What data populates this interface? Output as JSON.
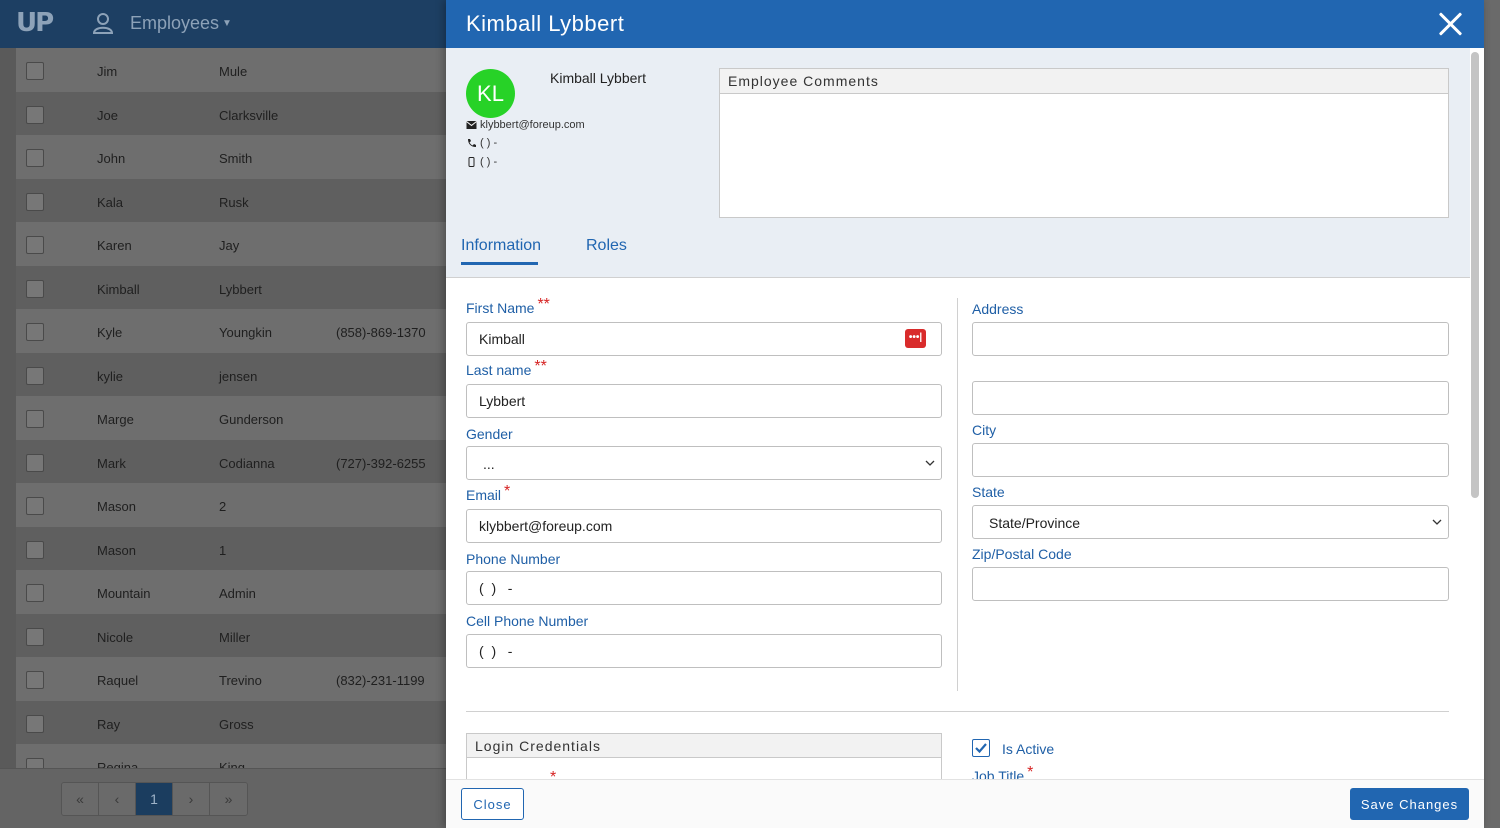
{
  "background": {
    "logo": "UP",
    "module_title": "Employees",
    "rows": [
      {
        "first": "Jim",
        "last": "Mule",
        "phone": ""
      },
      {
        "first": "Joe",
        "last": "Clarksville",
        "phone": ""
      },
      {
        "first": "John",
        "last": "Smith",
        "phone": ""
      },
      {
        "first": "Kala",
        "last": "Rusk",
        "phone": ""
      },
      {
        "first": "Karen",
        "last": "Jay",
        "phone": ""
      },
      {
        "first": "Kimball",
        "last": "Lybbert",
        "phone": ""
      },
      {
        "first": "Kyle",
        "last": "Youngkin",
        "phone": "(858)-869-1370"
      },
      {
        "first": "kylie",
        "last": "jensen",
        "phone": ""
      },
      {
        "first": "Marge",
        "last": "Gunderson",
        "phone": ""
      },
      {
        "first": "Mark",
        "last": "Codianna",
        "phone": "(727)-392-6255"
      },
      {
        "first": "Mason",
        "last": "2",
        "phone": ""
      },
      {
        "first": "Mason",
        "last": "1",
        "phone": ""
      },
      {
        "first": "Mountain",
        "last": "Admin",
        "phone": ""
      },
      {
        "first": "Nicole",
        "last": "Miller",
        "phone": ""
      },
      {
        "first": "Raquel",
        "last": "Trevino",
        "phone": "(832)-231-1199"
      },
      {
        "first": "Ray",
        "last": "Gross",
        "phone": ""
      },
      {
        "first": "Regina",
        "last": "King",
        "phone": ""
      }
    ],
    "pager": {
      "first": "«",
      "prev": "‹",
      "current": "1",
      "next": "›",
      "last": "»"
    }
  },
  "modal": {
    "title": "Kimball Lybbert",
    "profile": {
      "initials": "KL",
      "name": "Kimball Lybbert",
      "email": "klybbert@foreup.com",
      "phone": "( ) -",
      "cell": "( ) -"
    },
    "comments_title": "Employee Comments",
    "tabs": [
      "Information",
      "Roles"
    ],
    "fields": {
      "first_name": {
        "label": "First Name",
        "req": "**",
        "value": "Kimball"
      },
      "last_name": {
        "label": "Last name",
        "req": "**",
        "value": "Lybbert"
      },
      "gender": {
        "label": "Gender",
        "value": "..."
      },
      "email": {
        "label": "Email",
        "req": "*",
        "value": "klybbert@foreup.com"
      },
      "phone": {
        "label": "Phone Number",
        "value": "(  )   -"
      },
      "cell": {
        "label": "Cell Phone Number",
        "value": "(  )   -"
      },
      "address": {
        "label": "Address",
        "value": "",
        "value2": ""
      },
      "city": {
        "label": "City",
        "value": ""
      },
      "state": {
        "label": "State",
        "value": "State/Province"
      },
      "zip": {
        "label": "Zip/Postal Code",
        "value": ""
      }
    },
    "password_badge": "•••|",
    "login_title": "Login Credentials",
    "login_req": "*",
    "is_active": "Is Active",
    "job_title": {
      "label": "Job Title",
      "req": "*"
    },
    "close_label": "Close",
    "save_label": "Save Changes"
  },
  "colors": {
    "primary": "#2166b1",
    "avatar": "#27d227",
    "required": "#d62323"
  }
}
